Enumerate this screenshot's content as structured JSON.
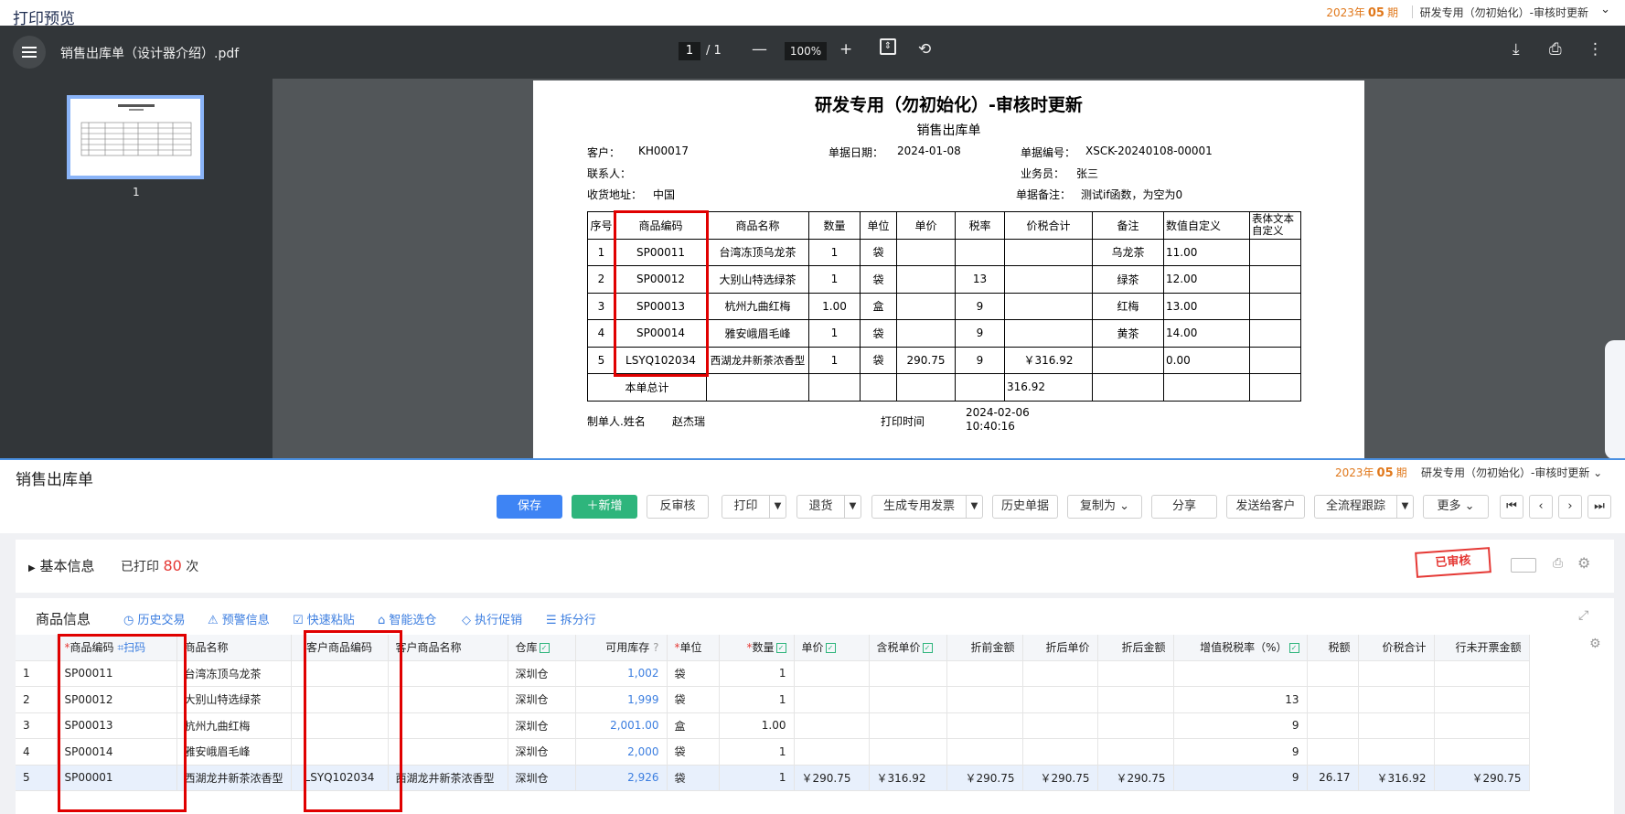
{
  "app": {
    "title": "打印预览",
    "period_year": "2023年",
    "period_num": "05",
    "period_unit": "期",
    "account": "研发专用（勿初始化）-审核时更新"
  },
  "pdf": {
    "filename": "销售出库单（设计器介绍）.pdf",
    "page_current": "1",
    "page_sep": "/",
    "page_total": "1",
    "zoom": "100%",
    "thumb_label": "1",
    "doc": {
      "title": "研发专用（勿初始化）-审核时更新",
      "subtitle": "销售出库单",
      "fields": {
        "customer_label": "客户：",
        "customer": "KH00017",
        "date_label": "单据日期：",
        "date": "2024-01-08",
        "no_label": "单据编号：",
        "no": "XSCK-20240108-00001",
        "contact_label": "联系人：",
        "sales_label": "业务员：",
        "sales": "张三",
        "addr_label": "收货地址：",
        "addr": "中国",
        "remark_label": "单据备注：",
        "remark": "测试if函数，为空为0"
      },
      "headers": [
        "序号",
        "商品编码",
        "商品名称",
        "数量",
        "单位",
        "单价",
        "税率",
        "价税合计",
        "备注",
        "数值自定义",
        "表体文本自定义"
      ],
      "rows": [
        [
          "1",
          "SP00011",
          "台湾冻顶乌龙茶",
          "1",
          "袋",
          "",
          "",
          "",
          "乌龙茶",
          "11.00",
          ""
        ],
        [
          "2",
          "SP00012",
          "大别山特选绿茶",
          "1",
          "袋",
          "",
          "13",
          "",
          "绿茶",
          "12.00",
          ""
        ],
        [
          "3",
          "SP00013",
          "杭州九曲红梅",
          "1.00",
          "盒",
          "",
          "9",
          "",
          "红梅",
          "13.00",
          ""
        ],
        [
          "4",
          "SP00014",
          "雅安峨眉毛峰",
          "1",
          "袋",
          "",
          "9",
          "",
          "黄茶",
          "14.00",
          ""
        ],
        [
          "5",
          "LSYQ102034",
          "西湖龙井新茶浓香型",
          "1",
          "袋",
          "290.75",
          "9",
          "￥316.92",
          "",
          "0.00",
          ""
        ]
      ],
      "total_label": "本单总计",
      "total": "316.92",
      "maker_label": "制单人.姓名",
      "maker": "赵杰瑞",
      "print_time_label": "打印时间",
      "print_time": "2024-02-06 10:40:16"
    }
  },
  "erp": {
    "title": "销售出库单",
    "buttons": {
      "save": "保存",
      "add": "新增",
      "unaudit": "反审核",
      "print": "打印",
      "return": "退货",
      "gen_invoice": "生成专用发票",
      "history": "历史单据",
      "copy": "复制为",
      "share": "分享",
      "send": "发送给客户",
      "trace": "全流程跟踪",
      "more": "更多"
    },
    "basic_label": "基本信息",
    "printed_prefix": "已打印",
    "printed_count": "80",
    "printed_suffix": "次",
    "stamp": "已审核",
    "goods_label": "商品信息",
    "tools": [
      "历史交易",
      "预警信息",
      "快速粘贴",
      "智能选仓",
      "执行促销",
      "拆分行"
    ],
    "scan_label": "扫码",
    "columns": [
      "商品编码",
      "商品名称",
      "客户商品编码",
      "客户商品名称",
      "仓库",
      "可用库存",
      "单位",
      "数量",
      "单价",
      "含税单价",
      "折前金额",
      "折后单价",
      "折后金额",
      "增值税税率（%）",
      "税额",
      "价税合计",
      "行未开票金额"
    ],
    "rows": [
      [
        "1",
        "SP00011",
        "台湾冻顶乌龙茶",
        "",
        "",
        "深圳仓",
        "1,002",
        "袋",
        "1",
        "",
        "",
        "",
        "",
        "",
        "",
        "",
        "",
        ""
      ],
      [
        "2",
        "SP00012",
        "大别山特选绿茶",
        "",
        "",
        "深圳仓",
        "1,999",
        "袋",
        "1",
        "",
        "",
        "",
        "",
        "",
        "13",
        "",
        "",
        ""
      ],
      [
        "3",
        "SP00013",
        "杭州九曲红梅",
        "",
        "",
        "深圳仓",
        "2,001.00",
        "盒",
        "1.00",
        "",
        "",
        "",
        "",
        "",
        "9",
        "",
        "",
        ""
      ],
      [
        "4",
        "SP00014",
        "雅安峨眉毛峰",
        "",
        "",
        "深圳仓",
        "2,000",
        "袋",
        "1",
        "",
        "",
        "",
        "",
        "",
        "9",
        "",
        "",
        ""
      ],
      [
        "5",
        "SP00001",
        "西湖龙井新茶浓香型",
        "LSYQ102034",
        "西湖龙井新茶浓香型",
        "深圳仓",
        "2,926",
        "袋",
        "1",
        "￥290.75",
        "￥316.92",
        "￥290.75",
        "￥290.75",
        "￥290.75",
        "9",
        "26.17",
        "￥316.92",
        "￥290.75"
      ]
    ]
  }
}
